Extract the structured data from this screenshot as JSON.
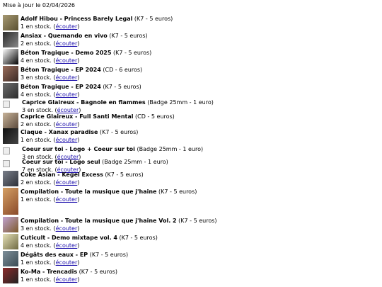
{
  "update_text": "Mise à jour le 02/04/2026",
  "listen_label": "écouter",
  "items": [
    {
      "title": "Adolf Hibou - Princess Barely Legal",
      "detail": "(K7 - 5 euros)",
      "stock": "1 en stock.",
      "thumb": "image",
      "colors": [
        "#a79a73",
        "#5a5031"
      ]
    },
    {
      "title": "Ansiax - Quemando en vivo",
      "detail": "(K7 - 5 euros)",
      "stock": "2 en stock.",
      "thumb": "image",
      "colors": [
        "#2b2b2b",
        "#888"
      ]
    },
    {
      "title": "Béton Tragique - Demo 2025",
      "detail": "(K7 - 5 euros)",
      "stock": "4 en stock.",
      "thumb": "image",
      "colors": [
        "#ffffff",
        "#000"
      ]
    },
    {
      "title": "Béton Tragique - EP 2024",
      "detail": "(CD - 6 euros)",
      "stock": "3 en stock.",
      "thumb": "image",
      "colors": [
        "#9a6d5b",
        "#3b2a25"
      ]
    },
    {
      "title": "Béton Tragique - EP 2024",
      "detail": "(K7 - 5 euros)",
      "stock": "4 en stock.",
      "thumb": "image",
      "colors": [
        "#6d6d6d",
        "#2d2d2d"
      ]
    },
    {
      "title": "Caprice Glaireux - Bagnole en flammes",
      "detail": "(Badge 25mm - 1 euro)",
      "stock": "3 en stock.",
      "thumb": "broken",
      "colors": []
    },
    {
      "title": "Caprice Glaireux - Full Santi Mental",
      "detail": "(CD - 5 euros)",
      "stock": "2 en stock.",
      "thumb": "image",
      "colors": [
        "#c8b49a",
        "#5d4b3d"
      ]
    },
    {
      "title": "Claque - Xanax paradise",
      "detail": "(K7 - 5 euros)",
      "stock": "1 en stock.",
      "thumb": "image",
      "colors": [
        "#111",
        "#444"
      ]
    },
    {
      "title": "Coeur sur toi - Logo + Coeur sur toi",
      "detail": "(Badge 25mm - 1 euro)",
      "stock": "3 en stock.",
      "thumb": "broken",
      "colors": []
    },
    {
      "title": "Coeur sur toi - Logo seul",
      "detail": "(Badge 25mm - 1 euro)",
      "stock": "7 en stock.",
      "thumb": "broken",
      "colors": []
    },
    {
      "title": "Coke Asian - Kegel Excess",
      "detail": "(K7 - 5 euros)",
      "stock": "2 en stock.",
      "thumb": "image",
      "colors": [
        "#7a7f8a",
        "#2e3139"
      ]
    },
    {
      "title": "Compilation - Toute la musique que j'haine",
      "detail": "(K7 - 5 euros)",
      "stock": "1 en stock.",
      "thumb": "tall",
      "colors": [
        "#d5a064",
        "#8a4a2a"
      ]
    },
    {
      "title": "Compilation - Toute la musique que j'haine Vol. 2",
      "detail": "(K7 - 5 euros)",
      "stock": "3 en stock.",
      "thumb": "image",
      "colors": [
        "#c1a3d1",
        "#7d5a2b"
      ]
    },
    {
      "title": "Cuticult - Demo mixtape vol. 4",
      "detail": "(K7 - 5 euros)",
      "stock": "4 en stock.",
      "thumb": "image",
      "colors": [
        "#e6e1b8",
        "#6f6a42"
      ]
    },
    {
      "title": "Dégâts des eaux - EP",
      "detail": "(K7 - 5 euros)",
      "stock": "1 en stock.",
      "thumb": "image",
      "colors": [
        "#7d8f9a",
        "#3c4c55"
      ]
    },
    {
      "title": "Ko-Ma - Trencadis",
      "detail": "(K7 - 5 euros)",
      "stock": "1 en stock.",
      "thumb": "image",
      "colors": [
        "#8b2a2a",
        "#222"
      ]
    }
  ]
}
